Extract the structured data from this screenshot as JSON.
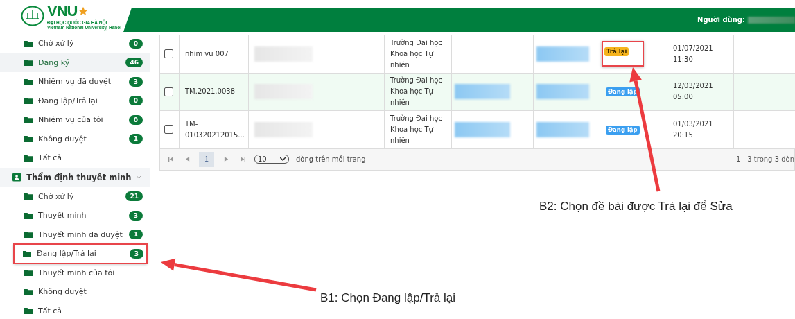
{
  "header": {
    "logo": {
      "title": "VNU",
      "subtitle": "ĐẠI HỌC QUỐC GIA HÀ NỘI",
      "subtitle_en": "Vietnam National University, Hanoi"
    },
    "user_label": "Người dùng:"
  },
  "sidebar": {
    "groups": [
      {
        "items": [
          {
            "label": "Chờ xử lý",
            "count": "0",
            "selected": false,
            "annotated": false
          },
          {
            "label": "Đăng ký",
            "count": "46",
            "selected": true,
            "annotated": false
          },
          {
            "label": "Nhiệm vụ đã duyệt",
            "count": "3",
            "selected": false,
            "annotated": false
          },
          {
            "label": "Đang lập/Trả lại",
            "count": "0",
            "selected": false,
            "annotated": false
          },
          {
            "label": "Nhiệm vụ của tôi",
            "count": "0",
            "selected": false,
            "annotated": false
          },
          {
            "label": "Không duyệt",
            "count": "1",
            "selected": false,
            "annotated": false
          },
          {
            "label": "Tất cả",
            "selected": false,
            "annotated": false
          }
        ]
      },
      {
        "title": "Thẩm định thuyết minh",
        "expanded": true,
        "items": [
          {
            "label": "Chờ xử lý",
            "count": "21",
            "selected": false,
            "annotated": false
          },
          {
            "label": "Thuyết minh",
            "count": "3",
            "selected": false,
            "annotated": false
          },
          {
            "label": "Thuyết minh đã duyệt",
            "count": "1",
            "selected": false,
            "annotated": false
          },
          {
            "label": "Đang lập/Trả lại",
            "count": "3",
            "selected": false,
            "annotated": true
          },
          {
            "label": "Thuyết minh của tôi",
            "selected": false,
            "annotated": false
          },
          {
            "label": "Không duyệt",
            "selected": false,
            "annotated": false
          },
          {
            "label": "Tất cả",
            "selected": false,
            "annotated": false
          }
        ]
      }
    ]
  },
  "table": {
    "rows": [
      {
        "checked": false,
        "selected": false,
        "code": "nhim vu 007",
        "unit": "Trường Đại học Khoa học Tự nhiên",
        "column_5_blurred": false,
        "status": {
          "label": "Trả lại",
          "kind": "returned",
          "annotated": true
        },
        "date": "01/07/2021",
        "time": "11:30"
      },
      {
        "checked": false,
        "selected": true,
        "code": "TM.2021.0038",
        "unit": "Trường Đại học Khoa học Tự nhiên",
        "column_5_blurred": true,
        "status": {
          "label": "Đang lập",
          "kind": "draft",
          "annotated": false
        },
        "date": "12/03/2021",
        "time": "05:00"
      },
      {
        "checked": false,
        "selected": false,
        "code": "TM-010320212015...",
        "unit": "Trường Đại học Khoa học Tự nhiên",
        "column_5_blurred": true,
        "status": {
          "label": "Đang lập",
          "kind": "draft",
          "annotated": false
        },
        "date": "01/03/2021",
        "time": "20:15"
      }
    ],
    "pagination": {
      "page": "1",
      "page_size": "10",
      "per_page_label": "dòng trên mỗi trang",
      "summary": "1 - 3 trong 3 dòn"
    }
  },
  "annotations": [
    {
      "kind": "left",
      "text": "B1: Chọn Đang lập/Trả lại"
    },
    {
      "kind": "up",
      "text": "B2: Chọn đề bài được Trả lại để Sửa"
    }
  ]
}
